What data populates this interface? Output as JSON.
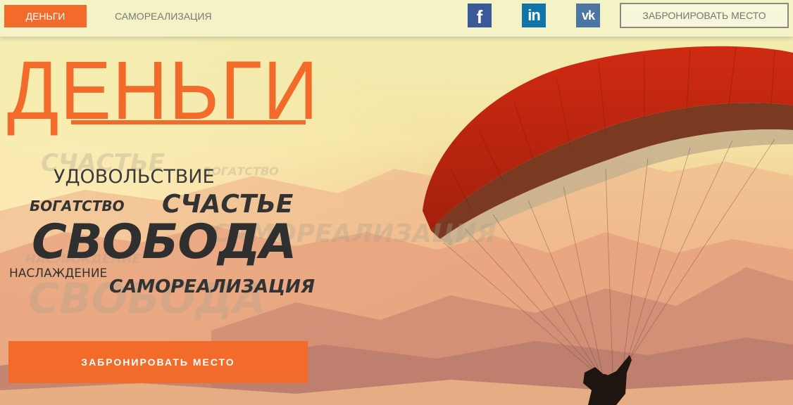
{
  "nav": {
    "active_tab": "ДЕНЬГИ",
    "tab_2": "САМОРЕАЛИЗАЦИЯ",
    "book_button": "ЗАБРОНИРОВАТЬ МЕСТО"
  },
  "social": [
    {
      "name": "facebook-icon",
      "glyph": "f"
    },
    {
      "name": "linkedin-icon",
      "glyph": "in"
    },
    {
      "name": "vk-icon",
      "glyph": "vk"
    }
  ],
  "hero": {
    "title": "ДЕНЬГИ",
    "words": {
      "pleasure": "УДОВОЛЬСТВИЕ",
      "wealth": "БОГАТСТВО",
      "happiness": "СЧАСТЬЕ",
      "freedom": "СВОБОДА",
      "delight": "НАСЛАЖДЕНИЕ",
      "self_realization": "САМОРЕАЛИЗАЦИЯ"
    },
    "cta": "ЗАБРОНИРОВАТЬ МЕСТО"
  },
  "colors": {
    "accent": "#f26b2a",
    "facebook": "#3b5998",
    "linkedin": "#0e76a8",
    "vk": "#4c75a3"
  }
}
